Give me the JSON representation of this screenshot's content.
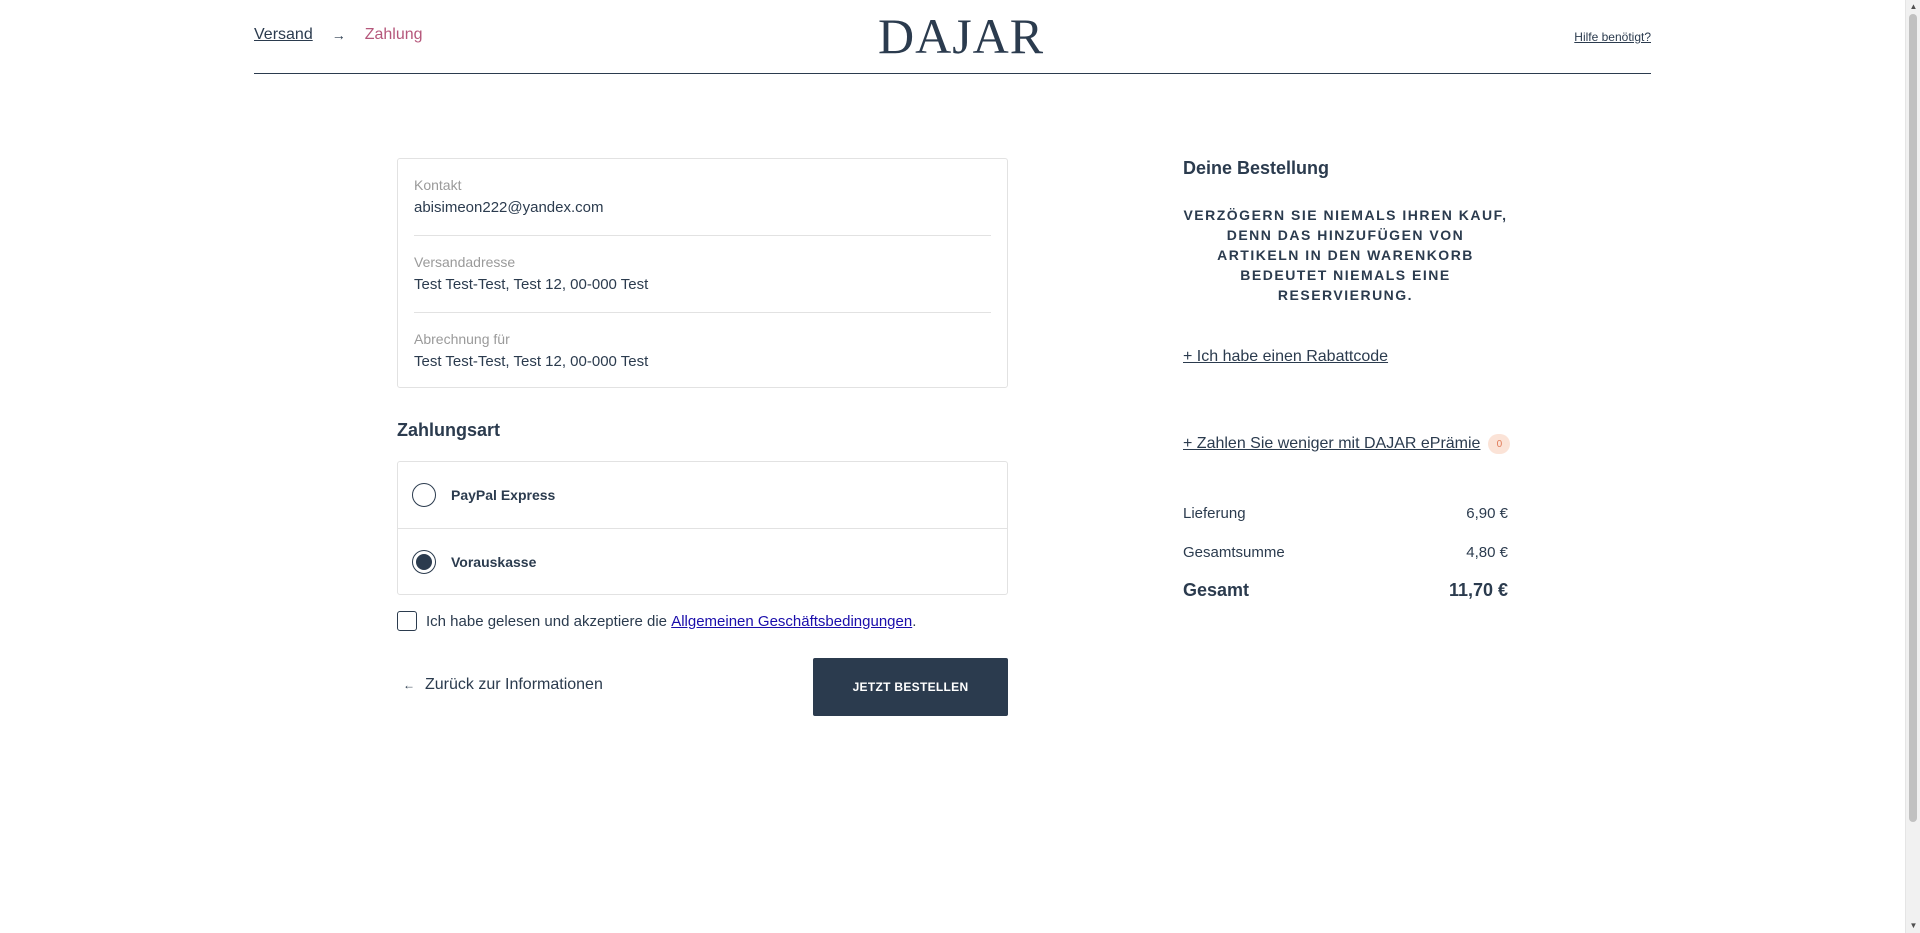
{
  "header": {
    "breadcrumb": {
      "step1": "Versand",
      "arrow": "→",
      "step2": "Zahlung"
    },
    "logo": "DAJAR",
    "help_label": "Hilfe benötigt?"
  },
  "summary": {
    "contact_label": "Kontakt",
    "contact_value": "abisimeon222@yandex.com",
    "shipping_label": "Versandadresse",
    "shipping_value": "Test Test-Test, Test 12, 00-000 Test",
    "billing_label": "Abrechnung für",
    "billing_value": "Test Test-Test, Test 12, 00-000 Test"
  },
  "payment": {
    "title": "Zahlungsart",
    "options": [
      {
        "label": "PayPal Express",
        "selected": false
      },
      {
        "label": "Vorauskasse",
        "selected": true
      }
    ]
  },
  "terms": {
    "text_before": "Ich habe gelesen und akzeptiere die ",
    "link_text": "Allgemeinen Geschäftsbedingungen",
    "text_after": "."
  },
  "actions": {
    "back_arrow": "←",
    "back_label": "Zurück zur Informationen",
    "order_label": "JETZT BESTELLEN"
  },
  "order": {
    "title": "Deine Bestellung",
    "notice": "VERZÖGERN SIE NIEMALS IHREN KAUF, DENN DAS HINZUFÜGEN VON ARTIKELN IN DEN WARENKORB BEDEUTET NIEMALS EINE RESERVIERUNG.",
    "discount_link": "+ Ich habe einen Rabattcode",
    "epraemie_link": "+ Zahlen Sie weniger mit DAJAR ePrämie",
    "epraemie_badge": "0",
    "delivery_label": "Lieferung",
    "delivery_value": "6,90 €",
    "subtotal_label": "Gesamtsumme",
    "subtotal_value": "4,80 €",
    "total_label": "Gesamt",
    "total_value": "11,70 €"
  },
  "colors": {
    "primary": "#2b3b4e",
    "breadcrumb_active": "#b5577b",
    "badge_bg": "#fbe3d7",
    "badge_text": "#e07a58",
    "link_blue": "#1a0dab"
  }
}
